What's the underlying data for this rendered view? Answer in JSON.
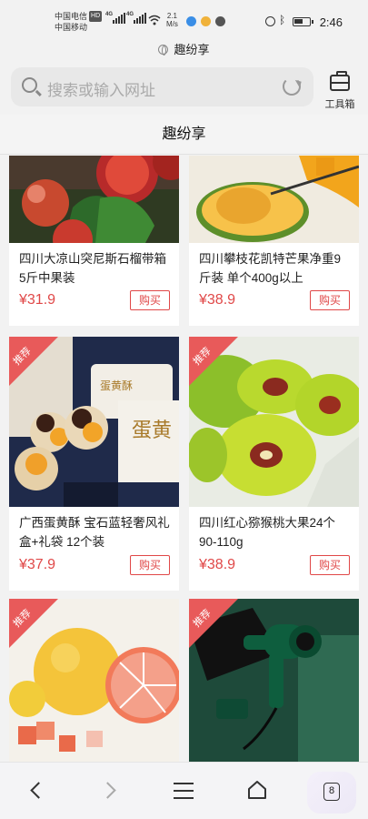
{
  "status_bar": {
    "carrier_1": "中国电信",
    "carrier_1_badge": "HD",
    "carrier_2": "中国移动",
    "net_1": "4G",
    "net_2": "4G",
    "speed_value": "2.1",
    "speed_unit": "M/s",
    "time": "2:46"
  },
  "site": {
    "name": "趣纷享"
  },
  "search": {
    "placeholder": "搜索或输入网址"
  },
  "toolbox": {
    "label": "工具箱"
  },
  "page": {
    "title": "趣纷享"
  },
  "products": [
    {
      "title": "四川大凉山突尼斯石榴带箱5斤中果装",
      "price": "¥31.9",
      "buy_label": "购买",
      "badge": ""
    },
    {
      "title": "四川攀枝花凯特芒果净重9斤装 单个400g以上",
      "price": "¥38.9",
      "buy_label": "购买",
      "badge": ""
    },
    {
      "title": "广西蛋黄酥 宝石蓝轻奢风礼盒+礼袋 12个装",
      "price": "¥37.9",
      "buy_label": "购买",
      "badge": "推荐"
    },
    {
      "title": "四川红心猕猴桃大果24个90-110g",
      "price": "¥38.9",
      "buy_label": "购买",
      "badge": "推荐"
    },
    {
      "title": "",
      "price": "",
      "buy_label": "",
      "badge": "推荐"
    },
    {
      "title": "",
      "price": "",
      "buy_label": "",
      "badge": "推荐"
    }
  ],
  "bottom_nav": {
    "tab_count": "8"
  },
  "colors": {
    "price_red": "#e04848",
    "badge_red": "#e85a5a"
  }
}
